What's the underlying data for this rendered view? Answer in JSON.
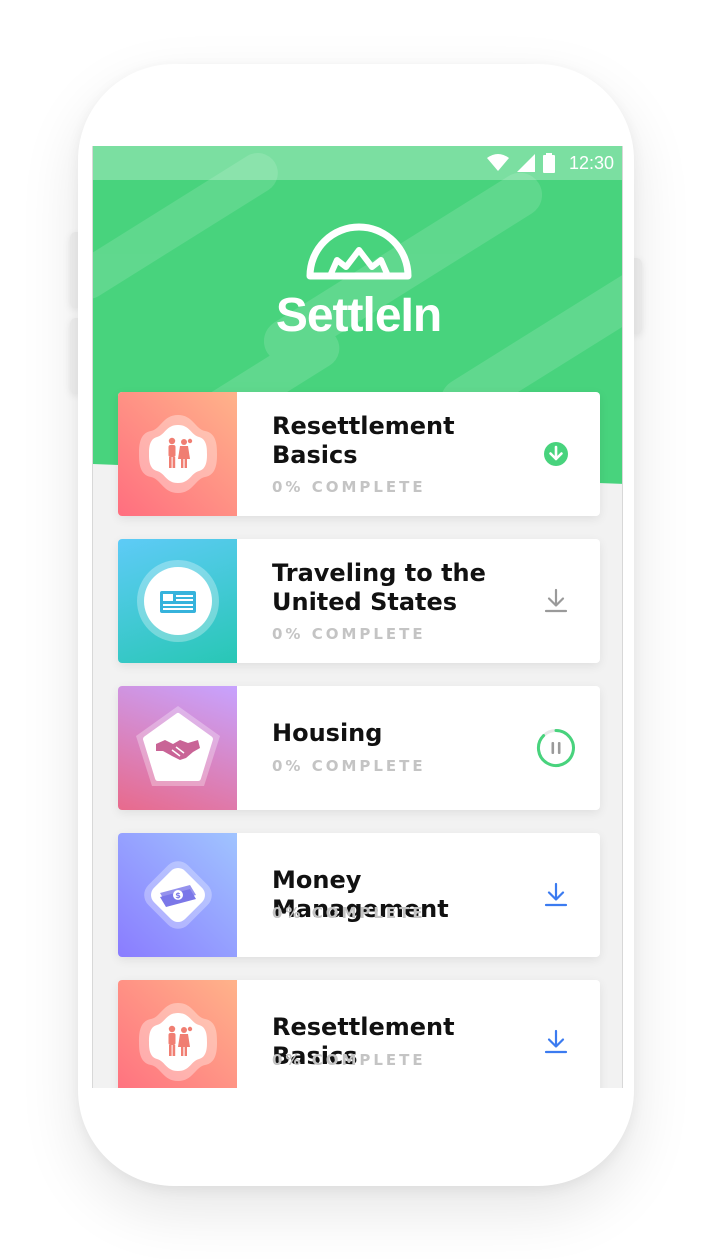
{
  "status_bar": {
    "time": "12:30"
  },
  "app": {
    "name": "SettleIn"
  },
  "colors": {
    "primary_green": "#48d37d",
    "download_blue": "#3b7bf0",
    "muted_gray": "#9a9a9a",
    "progress_text": "#c4c4c4"
  },
  "courses": [
    {
      "title": "Resettlement Basics",
      "progress": "0% COMPLETE",
      "icon": "family-icon",
      "action": "downloaded-check-icon"
    },
    {
      "title": "Traveling to the United States",
      "progress": "0% COMPLETE",
      "icon": "passport-icon",
      "action": "download-icon"
    },
    {
      "title": "Housing",
      "progress": "0% COMPLETE",
      "icon": "handshake-icon",
      "action": "pause-download-icon"
    },
    {
      "title": "Money Management",
      "progress": "0% COMPLETE",
      "icon": "money-icon",
      "action": "download-icon"
    },
    {
      "title": "Resettlement Basics",
      "progress": "0% COMPLETE",
      "icon": "family-icon",
      "action": "download-icon"
    }
  ]
}
